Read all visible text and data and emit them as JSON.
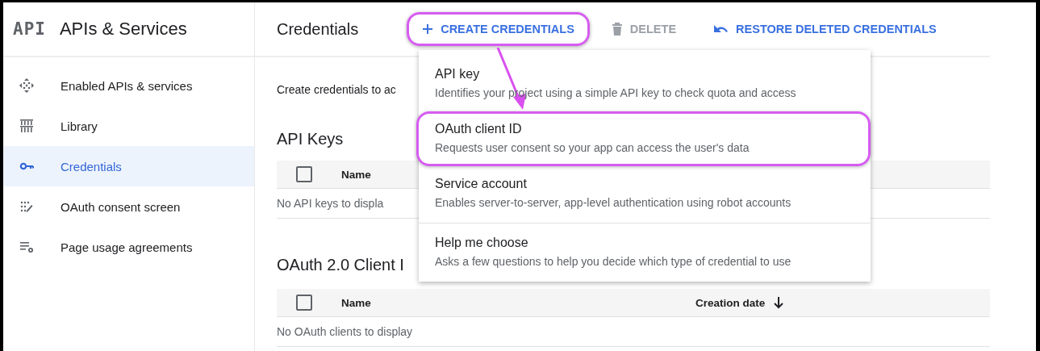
{
  "app": {
    "logo": "API",
    "title": "APIs & Services"
  },
  "sidebar": {
    "items": [
      {
        "label": "Enabled APIs & services",
        "kind": "enabled",
        "selected": false
      },
      {
        "label": "Library",
        "kind": "library",
        "selected": false
      },
      {
        "label": "Credentials",
        "kind": "key",
        "selected": true
      },
      {
        "label": "OAuth consent screen",
        "kind": "consent",
        "selected": false
      },
      {
        "label": "Page usage agreements",
        "kind": "agreements",
        "selected": false
      }
    ]
  },
  "page": {
    "title": "Credentials"
  },
  "toolbar": [
    {
      "kind": "create",
      "label": "CREATE CREDENTIALS",
      "disabled": false,
      "highlighted": true
    },
    {
      "kind": "delete",
      "label": "DELETE",
      "disabled": true,
      "highlighted": false
    },
    {
      "kind": "restore",
      "label": "RESTORE DELETED CREDENTIALS",
      "disabled": false,
      "highlighted": false
    }
  ],
  "intro": "Create credentials to ac",
  "sections": [
    {
      "heading": "API Keys",
      "checked": false,
      "columns": [
        {
          "label": "Name"
        }
      ],
      "empty_text": "No API keys to displa"
    },
    {
      "heading": "OAuth 2.0 Client I",
      "checked": false,
      "columns": [
        {
          "label": "Name"
        },
        {
          "label": "Creation date",
          "sorted": true
        }
      ],
      "empty_text": "No OAuth clients to display"
    }
  ],
  "menu": {
    "items": [
      {
        "title": "API key",
        "description": "Identifies your project using a simple API key to check quota and access",
        "highlighted": false,
        "divider_before": false
      },
      {
        "title": "OAuth client ID",
        "description": "Requests user consent so your app can access the user's data",
        "highlighted": true,
        "divider_before": false
      },
      {
        "title": "Service account",
        "description": "Enables server-to-server, app-level authentication using robot accounts",
        "highlighted": false,
        "divider_before": false
      },
      {
        "title": "Help me choose",
        "description": "Asks a few questions to help you decide which type of credential to use",
        "highlighted": false,
        "divider_before": true
      }
    ]
  }
}
